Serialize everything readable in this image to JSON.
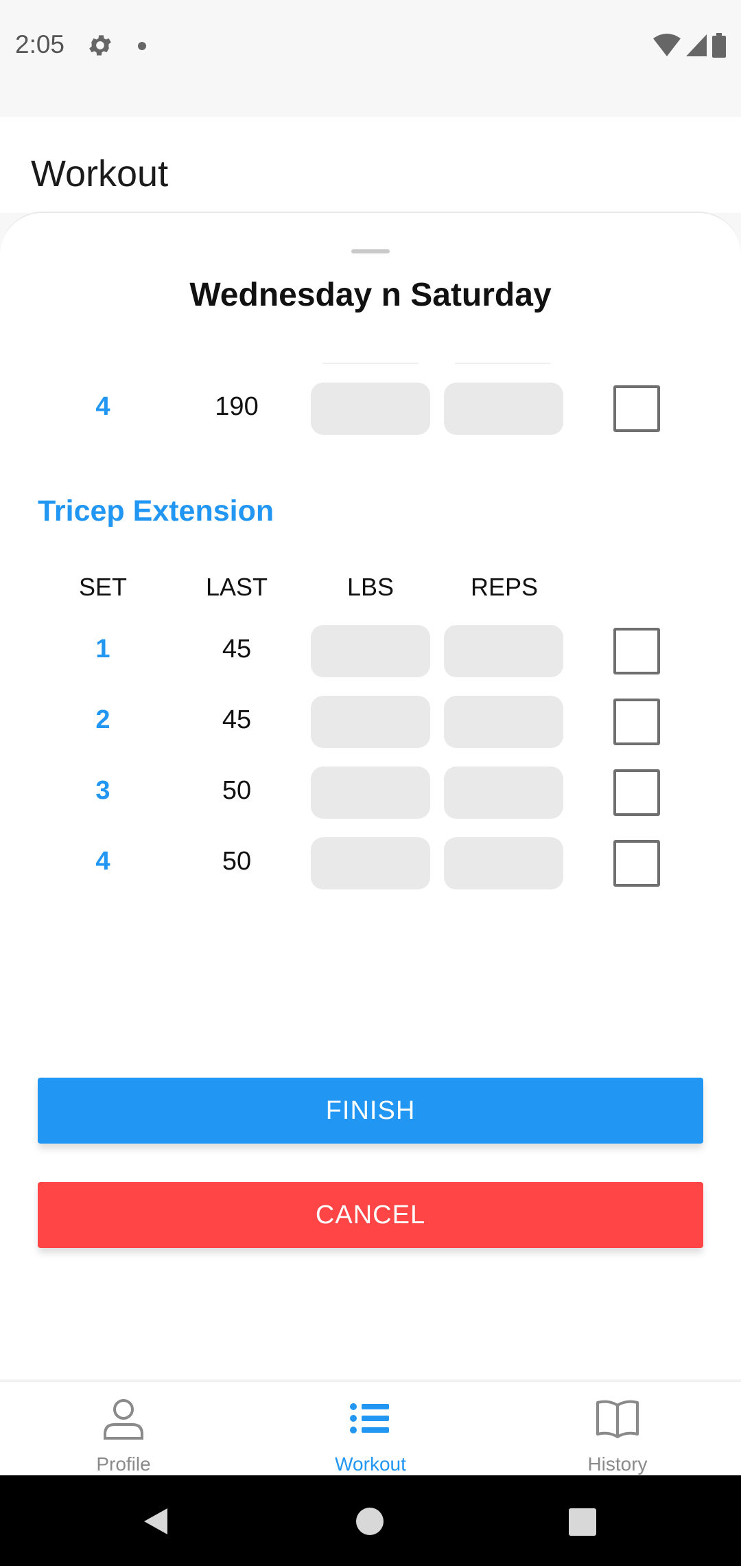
{
  "status_bar": {
    "time": "2:05"
  },
  "header": {
    "title": "Workout"
  },
  "sheet": {
    "title": "Wednesday n Saturday",
    "previous_exercise_rows": [
      {
        "set": "4",
        "last": "190"
      }
    ],
    "exercise": {
      "name": "Tricep Extension",
      "columns": {
        "set": "SET",
        "last": "LAST",
        "lbs": "LBS",
        "reps": "REPS"
      },
      "rows": [
        {
          "set": "1",
          "last": "45"
        },
        {
          "set": "2",
          "last": "45"
        },
        {
          "set": "3",
          "last": "50"
        },
        {
          "set": "4",
          "last": "50"
        }
      ]
    },
    "buttons": {
      "finish": "FINISH",
      "cancel": "CANCEL"
    }
  },
  "bottom_nav": {
    "items": [
      {
        "label": "Profile",
        "icon": "person-icon",
        "active": false
      },
      {
        "label": "Workout",
        "icon": "list-icon",
        "active": true
      },
      {
        "label": "History",
        "icon": "book-icon",
        "active": false
      }
    ]
  },
  "colors": {
    "accent": "#2196f3",
    "cancel": "#ff4545"
  }
}
